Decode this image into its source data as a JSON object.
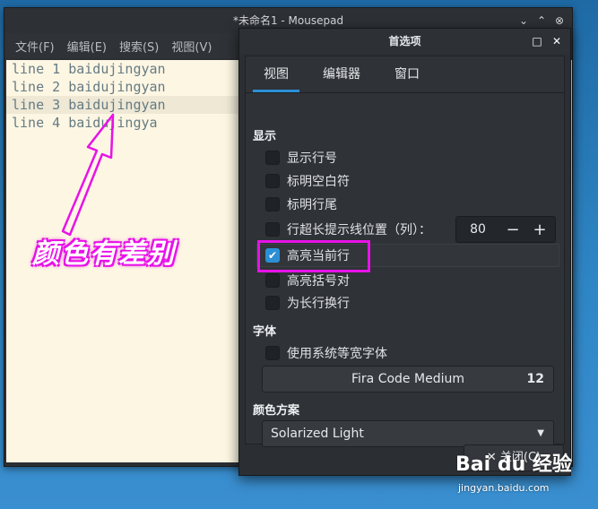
{
  "main_window": {
    "title": "*未命名1 - Mousepad",
    "controls": {
      "minimize": "⌄",
      "maximize": "⌃",
      "close": "⊗"
    },
    "menu": [
      "文件(F)",
      "编辑(E)",
      "搜索(S)",
      "视图(V)"
    ],
    "editor_lines": [
      "line 1 baidujingyan",
      "line 2 baidujingyan",
      "line 3 baidujingyan",
      "line 4 baidujingya"
    ],
    "current_line_index": 2
  },
  "annotation": {
    "text": "颜色有差别",
    "color": "#e812e8"
  },
  "preferences": {
    "title": "首选项",
    "controls": {
      "maximize": "□",
      "close": "✕"
    },
    "tabs": [
      {
        "label": "视图",
        "active": true
      },
      {
        "label": "编辑器",
        "active": false
      },
      {
        "label": "窗口",
        "active": false
      }
    ],
    "sections": {
      "display": {
        "title": "显示",
        "options": [
          {
            "label": "显示行号",
            "checked": false
          },
          {
            "label": "标明空白符",
            "checked": false
          },
          {
            "label": "标明行尾",
            "checked": false
          },
          {
            "label": "行超长提示线位置（列）：",
            "checked": false
          },
          {
            "label": "高亮当前行",
            "checked": true
          },
          {
            "label": "高亮括号对",
            "checked": false
          },
          {
            "label": "为长行换行",
            "checked": false
          }
        ],
        "long_line_column": "80",
        "spin_minus": "−",
        "spin_plus": "+"
      },
      "font": {
        "title": "字体",
        "option": {
          "label": "使用系统等宽字体",
          "checked": false
        },
        "font_name": "Fira Code Medium",
        "font_size": "12"
      },
      "color_scheme": {
        "title": "颜色方案",
        "selected": "Solarized Light"
      }
    },
    "close_button": {
      "icon": "✕",
      "label": "关闭(C)"
    }
  },
  "watermark": {
    "logo": "Bai du 经验",
    "url": "jingyan.baidu.com"
  },
  "colors": {
    "accent": "#2c8fd6",
    "editor_bg": "#fdf6e3",
    "current_line_bg": "#eee8d5",
    "annotation": "#e812e8"
  }
}
